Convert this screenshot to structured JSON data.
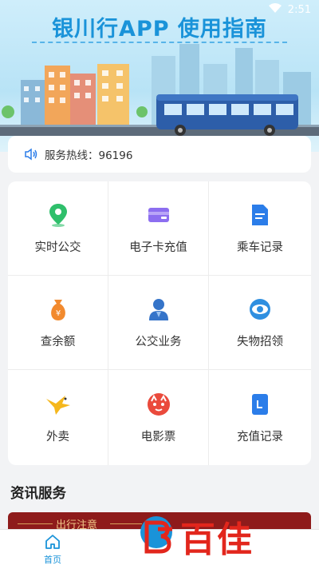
{
  "status_bar": {
    "time": "2:51",
    "wifi_icon": "wifi-icon"
  },
  "banner": {
    "title": "银川行APP 使用指南"
  },
  "hotline": {
    "icon": "speaker-icon",
    "text": "服务热线：96196"
  },
  "services": [
    {
      "label": "实时公交",
      "icon": "map-pin-icon",
      "color": "#2fbf6b"
    },
    {
      "label": "电子卡充值",
      "icon": "card-wallet-icon",
      "color": "#8c6ef0"
    },
    {
      "label": "乘车记录",
      "icon": "document-icon",
      "color": "#2b7de9"
    },
    {
      "label": "查余额",
      "icon": "money-bag-icon",
      "color": "#f28a2e"
    },
    {
      "label": "公交业务",
      "icon": "service-person-icon",
      "color": "#3574c9"
    },
    {
      "label": "失物招领",
      "icon": "eye-icon",
      "color": "#2f8fe0"
    },
    {
      "label": "外卖",
      "icon": "delivery-bird-icon",
      "color": "#f5b71d"
    },
    {
      "label": "电影票",
      "icon": "cat-face-icon",
      "color": "#ea4a3c"
    },
    {
      "label": "充值记录",
      "icon": "receipt-icon",
      "color": "#2b7de9"
    }
  ],
  "news": {
    "section_title": "资讯服务",
    "banner_label": "出行注意"
  },
  "bottom_nav": {
    "home_label": "首页",
    "home_icon": "home-icon"
  },
  "watermark": {
    "text": "百佳"
  },
  "colors": {
    "accent": "#1a93d9",
    "news_bg": "#8e1b1b",
    "watermark": "#e2261c"
  }
}
